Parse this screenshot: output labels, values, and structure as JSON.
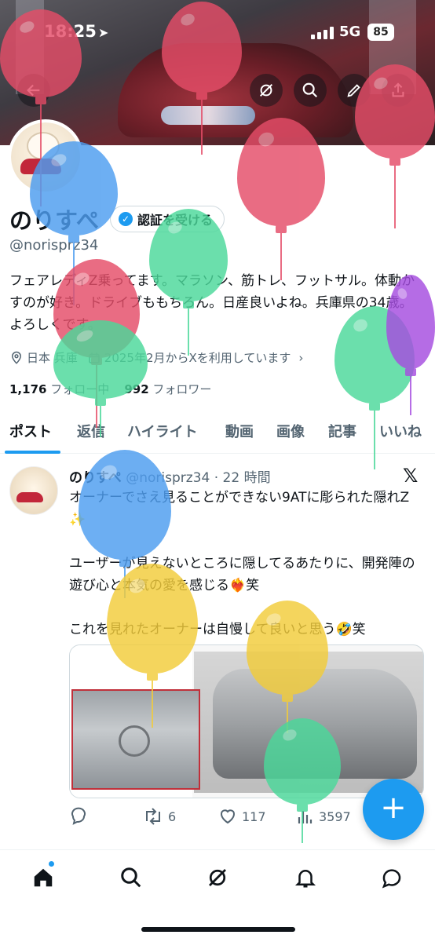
{
  "status_bar": {
    "time": "18:25",
    "network": "5G",
    "battery": "85"
  },
  "profile": {
    "name": "のりすぺ",
    "verify_button": "認証を受ける",
    "handle": "@norisprz34",
    "bio": "フェアレディZ乗ってます。マラソン、筋トレ、フットサル。体動かすのが好き。ドライブももちろん。日産良いよね。兵庫県の34歳。よろしくです。",
    "location": "日本 兵庫",
    "joined": "2025年2月からXを利用しています",
    "following_count": "1,176",
    "following_label": "フォロー中",
    "followers_count": "992",
    "followers_label": "フォロワー"
  },
  "tabs": [
    "ポスト",
    "返信",
    "ハイライト",
    "動画",
    "画像",
    "記事",
    "いいね"
  ],
  "tweet": {
    "author": "のりすぺ",
    "handle": "@norisprz34",
    "time": "22 時間",
    "text": "オーナーでさえ見ることができない9ATに彫られた隠れZ ✨\n\nユーザーが見えないところに隠してるあたりに、開発陣の遊び心と本気の愛を感じる❤️‍🔥笑\n\nこれを見れたオーナーは自慢して良いと思う🤣笑",
    "retweets": "6",
    "likes": "117",
    "views": "3597"
  },
  "colors": {
    "accent": "#1d9bf0",
    "text": "#0f1419",
    "muted": "#536471"
  },
  "icons": [
    "back-icon",
    "grok-icon",
    "search-icon",
    "edit-icon",
    "share-icon",
    "location-icon",
    "calendar-icon",
    "reply-icon",
    "retweet-icon",
    "like-icon",
    "views-icon",
    "plus-icon",
    "home-icon",
    "explore-icon",
    "grok-nav-icon",
    "notifications-icon",
    "messages-icon"
  ]
}
